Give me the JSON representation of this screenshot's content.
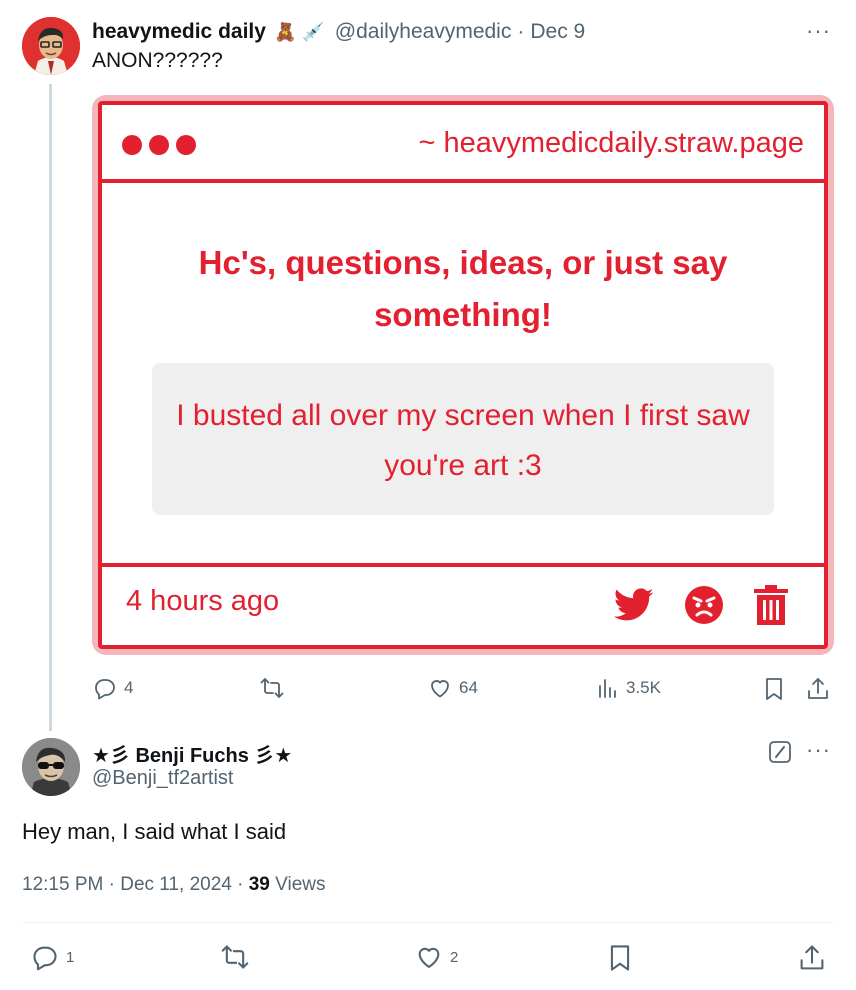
{
  "tweet1": {
    "name": "heavymedic daily",
    "emojis": [
      "🧸",
      "💉"
    ],
    "handle": "@dailyheavymedic",
    "separator": "·",
    "date": "Dec 9",
    "text": "ANON??????",
    "card": {
      "url": "~ heavymedicdaily.straw.page",
      "heading": "Hc's, questions, ideas, or just say something!",
      "message": "I busted all over my screen when I first saw you're art :3",
      "time": "4 hours ago",
      "icons": [
        "twitter-icon",
        "angry-face-icon",
        "trash-icon"
      ],
      "accent": "#e2202f"
    },
    "stats": {
      "replies": "4",
      "retweets": "",
      "likes": "64",
      "views": "3.5K"
    }
  },
  "tweet2": {
    "name": "★彡 Benji Fuchs 彡★",
    "handle": "@Benji_tf2artist",
    "text": "Hey man, I said what I said",
    "time": "12:15 PM",
    "sep": "·",
    "date": "Dec 11, 2024",
    "sep2": "·",
    "views_count": "39",
    "views_label": "Views",
    "stats": {
      "replies": "1",
      "retweets": "",
      "likes": "2"
    }
  },
  "more": "···"
}
